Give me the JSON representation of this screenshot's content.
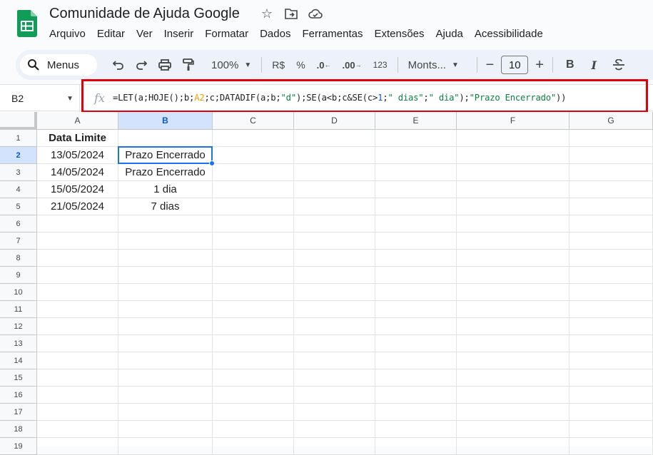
{
  "app": {
    "title": "Comunidade de Ajuda Google"
  },
  "menu": [
    "Arquivo",
    "Editar",
    "Ver",
    "Inserir",
    "Formatar",
    "Dados",
    "Ferramentas",
    "Extensões",
    "Ajuda",
    "Acessibilidade"
  ],
  "toolbar": {
    "search_label": "Menus",
    "zoom": "100%",
    "currency": "R$",
    "percent": "%",
    "decrease_decimal": ".0",
    "increase_decimal": ".00",
    "number_format": "123",
    "font": "Monts...",
    "font_size": "10",
    "bold": "B",
    "italic": "I"
  },
  "formula_bar": {
    "cell_ref": "B2",
    "fx": "fx",
    "formula_parts": {
      "p1": "=LET(a;HOJE();b;",
      "ref": "A2",
      "p2": ";c;DATADIF(a;b;",
      "s1": "\"d\"",
      "p3": ");SE(a<b;c&SE(c>",
      "n1": "1",
      "p4": ";",
      "s2": "\" dias\"",
      "p5": ";",
      "s3": "\" dia\"",
      "p6": ");",
      "s4": "\"Prazo Encerrado\"",
      "p7": "))"
    }
  },
  "sheet": {
    "columns": [
      "A",
      "B",
      "C",
      "D",
      "E",
      "F",
      "G"
    ],
    "rows": [
      "1",
      "2",
      "3",
      "4",
      "5",
      "6",
      "7",
      "8",
      "9",
      "10",
      "11",
      "12",
      "13",
      "14",
      "15",
      "16",
      "17",
      "18",
      "19"
    ],
    "cells": {
      "A1": "Data Limite",
      "A2": "13/05/2024",
      "B2": "Prazo Encerrado",
      "A3": "14/05/2024",
      "B3": "Prazo Encerrado",
      "A4": "15/05/2024",
      "B4": "1 dia",
      "A5": "21/05/2024",
      "B5": "7 dias"
    },
    "active_cell": "B2"
  },
  "colors": {
    "accent": "#1a73e8",
    "highlight": "#e0000a",
    "sheets_green": "#0f9d58"
  }
}
